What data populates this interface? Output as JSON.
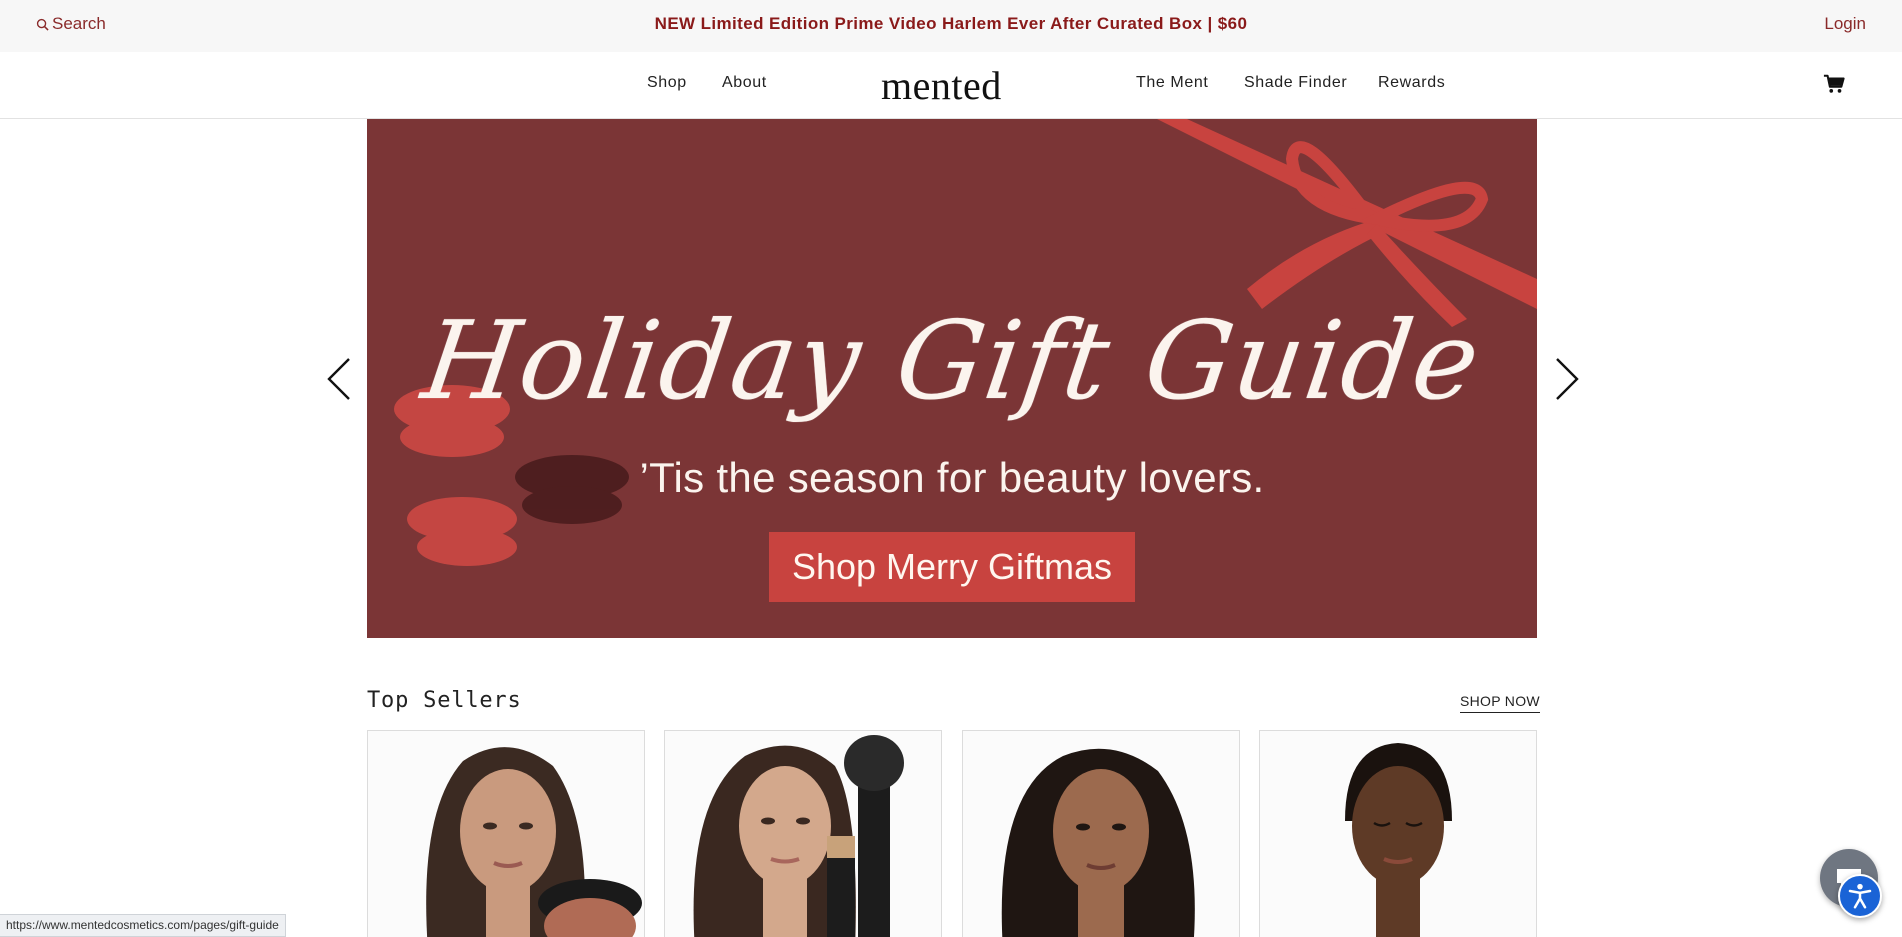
{
  "announcement": {
    "search_label": "Search",
    "message": "NEW Limited Edition Prime Video Harlem Ever After Curated Box | $60",
    "login_label": "Login"
  },
  "nav": {
    "logo": "mented",
    "left_items": [
      {
        "label": "Shop"
      },
      {
        "label": "About"
      }
    ],
    "right_items": [
      {
        "label": "The Ment"
      },
      {
        "label": "Shade Finder"
      },
      {
        "label": "Rewards"
      }
    ],
    "cart_icon": "cart-icon"
  },
  "hero": {
    "title": "Holiday Gift Guide",
    "subtitle": "’Tis the season for beauty lovers.",
    "cta": "Shop Merry Giftmas",
    "colors": {
      "background": "#7b3536",
      "ribbon": "#c8433f",
      "lips": "#d14a45",
      "dark_lips": "#4a1c1d"
    }
  },
  "top_sellers": {
    "title": "Top Sellers",
    "shop_now": "SHOP NOW"
  },
  "status_bar": {
    "url": "https://www.mentedcosmetics.com/pages/gift-guide"
  },
  "widgets": {
    "chat_icon": "chat-icon",
    "accessibility_icon": "accessibility-icon"
  }
}
